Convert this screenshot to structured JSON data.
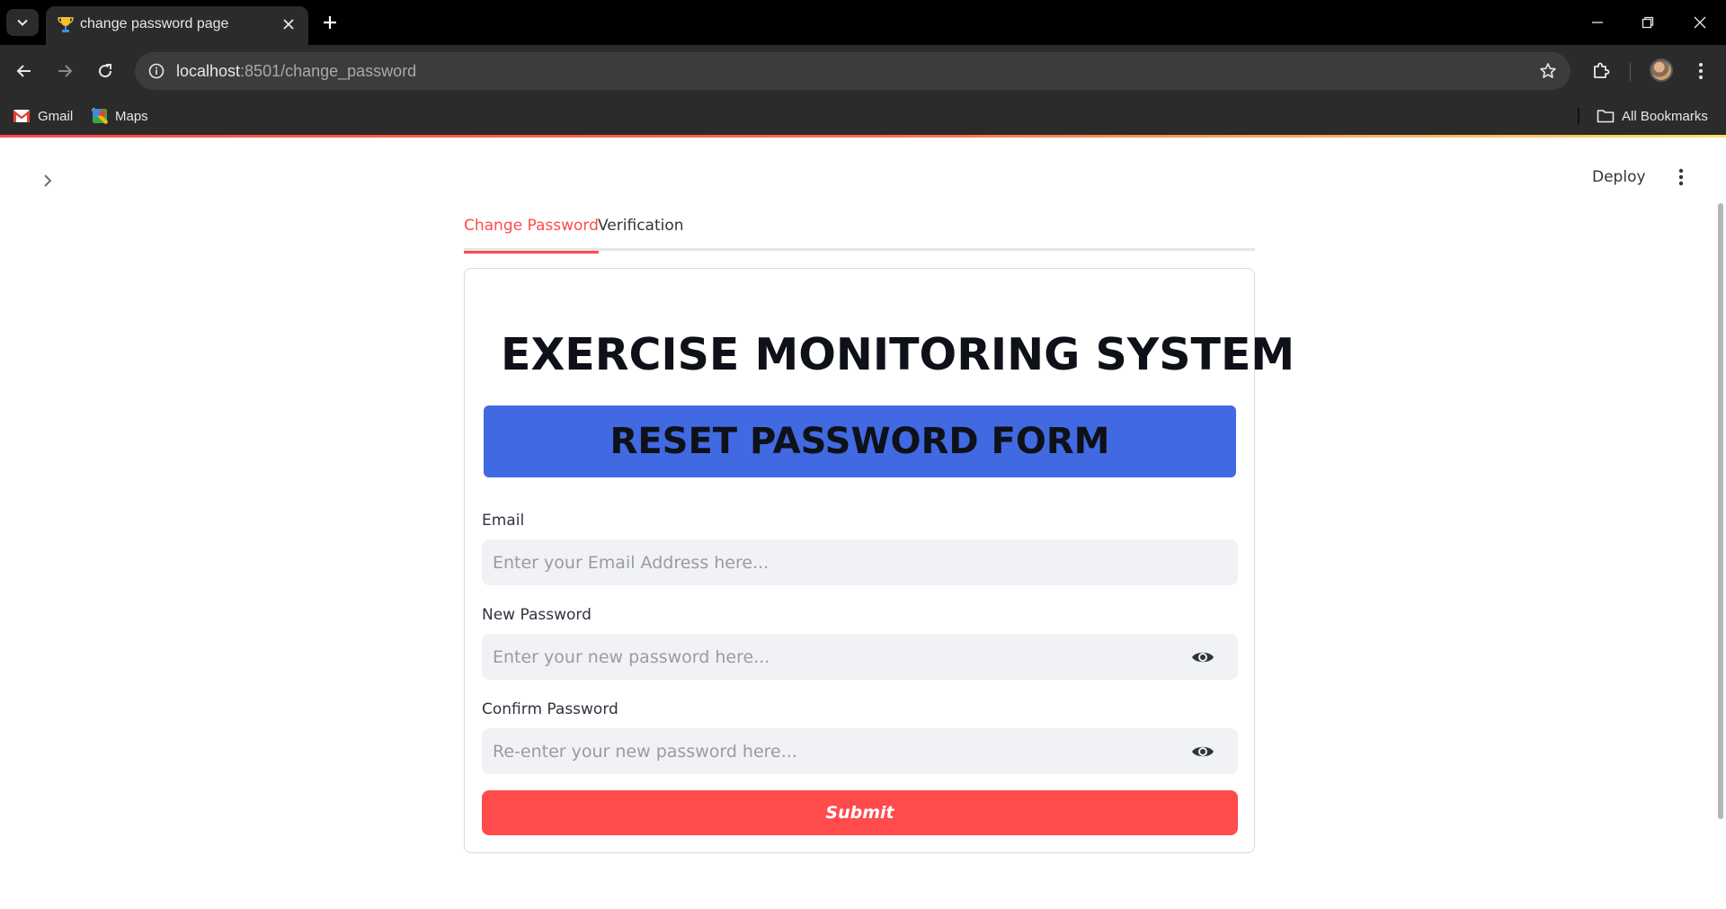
{
  "browser": {
    "tab_title": "change password page",
    "url_host": "localhost",
    "url_path": ":8501/change_password",
    "bookmarks": [
      {
        "label": "Gmail",
        "icon": "gmail-icon"
      },
      {
        "label": "Maps",
        "icon": "maps-icon"
      }
    ],
    "all_bookmarks_label": "All Bookmarks"
  },
  "app": {
    "deploy_label": "Deploy",
    "tabs": [
      {
        "label": "Change Password",
        "active": true
      },
      {
        "label": "Verification",
        "active": false
      }
    ],
    "title": "EXERCISE MONITORING SYSTEM",
    "banner": "RESET PASSWORD FORM",
    "banner_color": "#4169e1",
    "accent_color": "#ff4b4b",
    "form": {
      "email_label": "Email",
      "email_placeholder": "Enter your Email Address here...",
      "new_password_label": "New Password",
      "new_password_placeholder": "Enter your new password here...",
      "confirm_password_label": "Confirm Password",
      "confirm_password_placeholder": "Re-enter your new password here...",
      "submit_label": "Submit"
    }
  }
}
